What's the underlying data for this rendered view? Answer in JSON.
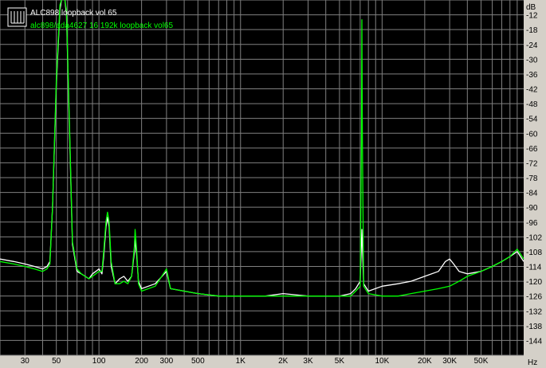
{
  "chart_data": {
    "type": "line",
    "title": "",
    "xlabel": "",
    "ylabel": "",
    "x_unit": "Hz",
    "y_unit": "dB",
    "x_scale": "log",
    "xlim": [
      20,
      100000
    ],
    "ylim": [
      -150,
      -6
    ],
    "x_ticks": [
      {
        "value": 30,
        "label": "30"
      },
      {
        "value": 50,
        "label": "50"
      },
      {
        "value": 100,
        "label": "100"
      },
      {
        "value": 200,
        "label": "200"
      },
      {
        "value": 300,
        "label": "300"
      },
      {
        "value": 500,
        "label": "500"
      },
      {
        "value": 1000,
        "label": "1K"
      },
      {
        "value": 2000,
        "label": "2K"
      },
      {
        "value": 3000,
        "label": "3K"
      },
      {
        "value": 5000,
        "label": "5K"
      },
      {
        "value": 10000,
        "label": "10K"
      },
      {
        "value": 20000,
        "label": "20K"
      },
      {
        "value": 30000,
        "label": "30K"
      },
      {
        "value": 50000,
        "label": "50K"
      }
    ],
    "y_ticks": [
      -12,
      -18,
      -24,
      -30,
      -36,
      -42,
      -48,
      -54,
      -60,
      -66,
      -72,
      -78,
      -84,
      -90,
      -96,
      -102,
      -108,
      -114,
      -120,
      -126,
      -132,
      -138,
      -144
    ],
    "grid": true,
    "legend_position": "top-left",
    "colors": {
      "background": "#000000",
      "grid": "#808080",
      "frame": "#d4d0c8"
    },
    "series": [
      {
        "name": "ALC898 loopback vol 65",
        "color": "#ffffff",
        "points": [
          [
            20,
            -111
          ],
          [
            25,
            -112
          ],
          [
            30,
            -113
          ],
          [
            35,
            -114
          ],
          [
            40,
            -115
          ],
          [
            43,
            -114
          ],
          [
            45,
            -112
          ],
          [
            47,
            -90
          ],
          [
            50,
            -40
          ],
          [
            53,
            -10
          ],
          [
            55,
            -4
          ],
          [
            57,
            -4
          ],
          [
            59,
            -12
          ],
          [
            62,
            -60
          ],
          [
            65,
            -105
          ],
          [
            70,
            -116
          ],
          [
            75,
            -117
          ],
          [
            80,
            -118
          ],
          [
            85,
            -119
          ],
          [
            90,
            -117
          ],
          [
            95,
            -116
          ],
          [
            100,
            -115
          ],
          [
            105,
            -117
          ],
          [
            108,
            -110
          ],
          [
            112,
            -98
          ],
          [
            115,
            -94
          ],
          [
            118,
            -98
          ],
          [
            122,
            -114
          ],
          [
            130,
            -121
          ],
          [
            140,
            -119
          ],
          [
            150,
            -118
          ],
          [
            160,
            -120
          ],
          [
            170,
            -118
          ],
          [
            178,
            -108
          ],
          [
            180,
            -103
          ],
          [
            185,
            -110
          ],
          [
            190,
            -120
          ],
          [
            200,
            -123
          ],
          [
            250,
            -121
          ],
          [
            300,
            -116
          ],
          [
            320,
            -123
          ],
          [
            400,
            -124
          ],
          [
            500,
            -125
          ],
          [
            700,
            -126
          ],
          [
            1000,
            -126
          ],
          [
            1500,
            -126
          ],
          [
            2000,
            -125
          ],
          [
            3000,
            -126
          ],
          [
            4000,
            -126
          ],
          [
            5000,
            -126
          ],
          [
            6000,
            -125
          ],
          [
            6500,
            -123
          ],
          [
            7000,
            -120
          ],
          [
            7200,
            -99
          ],
          [
            7400,
            -121
          ],
          [
            8000,
            -124
          ],
          [
            10000,
            -122
          ],
          [
            13000,
            -121
          ],
          [
            16000,
            -120
          ],
          [
            20000,
            -118
          ],
          [
            25000,
            -116
          ],
          [
            28000,
            -112
          ],
          [
            30000,
            -111
          ],
          [
            32000,
            -113
          ],
          [
            35000,
            -116
          ],
          [
            40000,
            -117
          ],
          [
            50000,
            -116
          ],
          [
            60000,
            -114
          ],
          [
            70000,
            -112
          ],
          [
            80000,
            -110
          ],
          [
            90000,
            -108
          ],
          [
            95000,
            -110
          ],
          [
            100000,
            -112
          ]
        ]
      },
      {
        "name": "alc898/ada4627 16 192k loopback vol65",
        "color": "#00ff00",
        "points": [
          [
            20,
            -112
          ],
          [
            25,
            -113
          ],
          [
            30,
            -114
          ],
          [
            35,
            -115
          ],
          [
            40,
            -116
          ],
          [
            43,
            -115
          ],
          [
            45,
            -113
          ],
          [
            47,
            -90
          ],
          [
            50,
            -38
          ],
          [
            53,
            -8
          ],
          [
            55,
            -5
          ],
          [
            57,
            -5
          ],
          [
            59,
            -10
          ],
          [
            62,
            -58
          ],
          [
            65,
            -104
          ],
          [
            70,
            -115
          ],
          [
            75,
            -117
          ],
          [
            80,
            -118
          ],
          [
            85,
            -119
          ],
          [
            90,
            -118
          ],
          [
            95,
            -117
          ],
          [
            100,
            -116
          ],
          [
            105,
            -116
          ],
          [
            108,
            -108
          ],
          [
            112,
            -96
          ],
          [
            115,
            -92
          ],
          [
            118,
            -96
          ],
          [
            122,
            -112
          ],
          [
            130,
            -121
          ],
          [
            140,
            -121
          ],
          [
            150,
            -120
          ],
          [
            160,
            -121
          ],
          [
            170,
            -118
          ],
          [
            178,
            -106
          ],
          [
            180,
            -99
          ],
          [
            185,
            -108
          ],
          [
            190,
            -121
          ],
          [
            200,
            -124
          ],
          [
            250,
            -122
          ],
          [
            300,
            -115
          ],
          [
            320,
            -123
          ],
          [
            400,
            -124
          ],
          [
            500,
            -125
          ],
          [
            700,
            -126
          ],
          [
            1000,
            -126
          ],
          [
            1500,
            -126
          ],
          [
            2000,
            -126
          ],
          [
            3000,
            -126
          ],
          [
            4000,
            -126
          ],
          [
            5000,
            -126
          ],
          [
            6000,
            -126
          ],
          [
            6500,
            -124
          ],
          [
            7000,
            -122
          ],
          [
            7150,
            -60
          ],
          [
            7200,
            -14
          ],
          [
            7250,
            -60
          ],
          [
            7400,
            -122
          ],
          [
            8000,
            -125
          ],
          [
            10000,
            -126
          ],
          [
            13000,
            -126
          ],
          [
            16000,
            -125
          ],
          [
            20000,
            -124
          ],
          [
            25000,
            -123
          ],
          [
            30000,
            -122
          ],
          [
            35000,
            -120
          ],
          [
            40000,
            -118
          ],
          [
            50000,
            -116
          ],
          [
            60000,
            -114
          ],
          [
            70000,
            -112
          ],
          [
            80000,
            -110
          ],
          [
            90000,
            -107
          ],
          [
            95000,
            -109
          ],
          [
            100000,
            -111
          ]
        ]
      }
    ]
  }
}
